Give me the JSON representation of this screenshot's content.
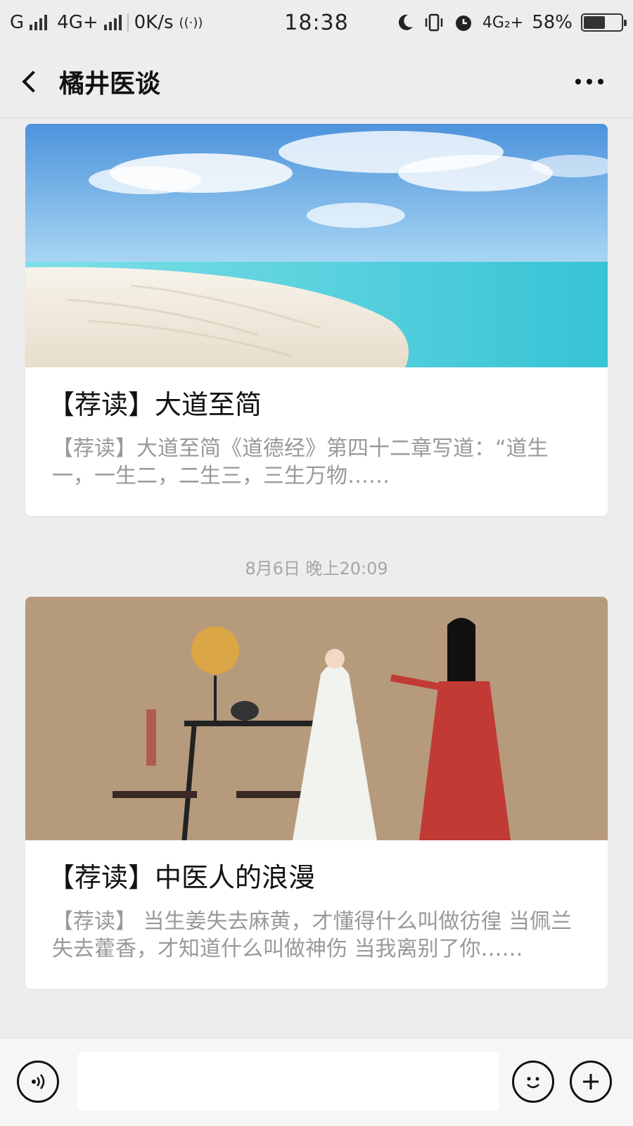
{
  "status_bar": {
    "carrier1": "G",
    "network1": "4G+",
    "speed": "0K/s",
    "hotspot_glyph": "((·))",
    "time": "18:38",
    "network2": "4G₂+",
    "battery_percent": "58%",
    "battery_level": 0.58
  },
  "nav": {
    "title": "橘井医谈",
    "back_icon": "chevron-left",
    "more_icon": "ellipsis"
  },
  "messages": [
    {
      "image": "beach-sea-sky",
      "title": "【荐读】大道至简",
      "digest": "【荐读】大道至简《道德经》第四十二章写道：“道生一，一生二，二生三，三生万物……"
    },
    {
      "timestamp": "8月6日 晚上20:09",
      "image": "ancient-tea-scene-painting",
      "title": "【荐读】中医人的浪漫",
      "digest": "【荐读】 当生姜失去麻黄，才懂得什么叫做彷徨 当佩兰失去藿香，才知道什么叫做神伤 当我离别了你……"
    }
  ],
  "input_bar": {
    "voice_icon": "voice",
    "emoji_icon": "emoji",
    "plus_icon": "plus"
  },
  "colors": {
    "background": "#ededed",
    "card": "#ffffff",
    "digest_text": "#999999",
    "timestamp_text": "#a6a6a6"
  }
}
